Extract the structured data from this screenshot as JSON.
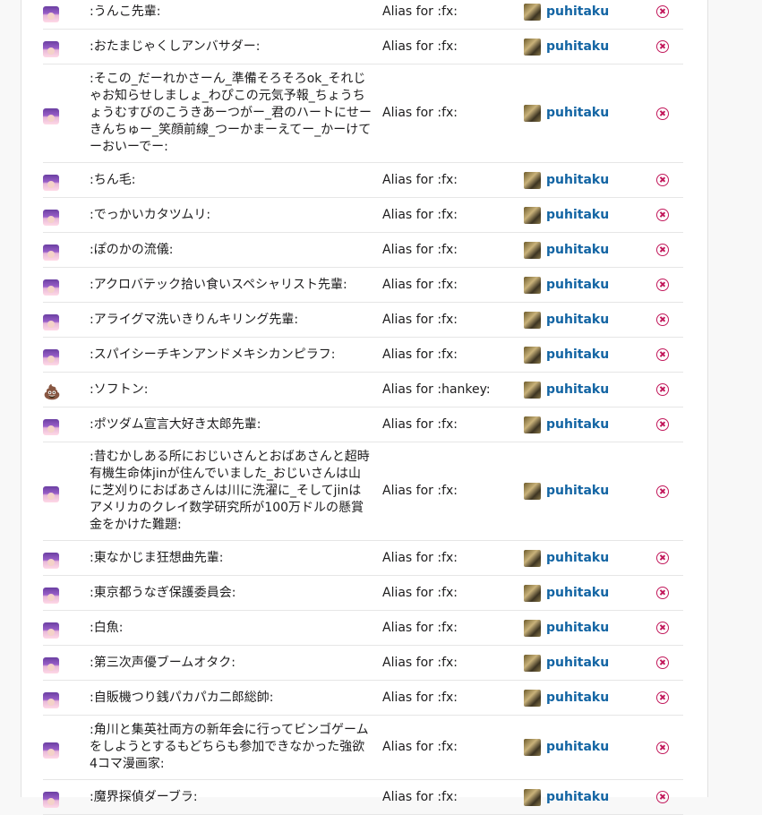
{
  "colors": {
    "link": "#1264a3",
    "remove": "#c2185b",
    "border": "#e6e6e6"
  },
  "rows": [
    {
      "emoji_icon": "anime-avatar-icon",
      "name": ":うんこ先輩:",
      "source": "Alias for :fx:",
      "user": "puhitaku"
    },
    {
      "emoji_icon": "anime-avatar-icon",
      "name": ":おたまじゃくしアンバサダー:",
      "source": "Alias for :fx:",
      "user": "puhitaku"
    },
    {
      "emoji_icon": "anime-avatar-icon",
      "name": ":そこの_だーれかさーん_準備そろそろok_それじゃお知らせしましょ_わぴこの元気予報_ちょうちょうむすびのこうきあーつがー_君のハートにせーきんちゅー_笑顔前線_つーかまーえてー_かーけてーおいーでー:",
      "source": "Alias for :fx:",
      "user": "puhitaku"
    },
    {
      "emoji_icon": "anime-avatar-icon",
      "name": ":ちん毛:",
      "source": "Alias for :fx:",
      "user": "puhitaku"
    },
    {
      "emoji_icon": "anime-avatar-icon",
      "name": ":でっかいカタツムリ:",
      "source": "Alias for :fx:",
      "user": "puhitaku"
    },
    {
      "emoji_icon": "anime-avatar-icon",
      "name": ":ぽのかの流儀:",
      "source": "Alias for :fx:",
      "user": "puhitaku"
    },
    {
      "emoji_icon": "anime-avatar-icon",
      "name": ":アクロバテック拾い食いスペシャリスト先輩:",
      "source": "Alias for :fx:",
      "user": "puhitaku"
    },
    {
      "emoji_icon": "anime-avatar-icon",
      "name": ":アライグマ洗いきりんキリング先輩:",
      "source": "Alias for :fx:",
      "user": "puhitaku"
    },
    {
      "emoji_icon": "anime-avatar-icon",
      "name": ":スパイシーチキンアンドメキシカンピラフ:",
      "source": "Alias for :fx:",
      "user": "puhitaku"
    },
    {
      "emoji_icon": "poop-icon",
      "name": ":ソフトン:",
      "source": "Alias for :hankey:",
      "user": "puhitaku"
    },
    {
      "emoji_icon": "anime-avatar-icon",
      "name": ":ポツダム宣言大好き太郎先輩:",
      "source": "Alias for :fx:",
      "user": "puhitaku"
    },
    {
      "emoji_icon": "anime-avatar-icon",
      "name": ":昔むかしある所におじいさんとおばあさんと超時有機生命体jinが住んでいました_おじいさんは山に芝刈りにおばあさんは川に洗濯に_そしてjinはアメリカのクレイ数学研究所が100万ドルの懸賞金をかけた難題:",
      "source": "Alias for :fx:",
      "user": "puhitaku"
    },
    {
      "emoji_icon": "anime-avatar-icon",
      "name": ":東なかじま狂想曲先輩:",
      "source": "Alias for :fx:",
      "user": "puhitaku"
    },
    {
      "emoji_icon": "anime-avatar-icon",
      "name": ":東京都うなぎ保護委員会:",
      "source": "Alias for :fx:",
      "user": "puhitaku"
    },
    {
      "emoji_icon": "anime-avatar-icon",
      "name": ":白魚:",
      "source": "Alias for :fx:",
      "user": "puhitaku"
    },
    {
      "emoji_icon": "anime-avatar-icon",
      "name": ":第三次声優ブームオタク:",
      "source": "Alias for :fx:",
      "user": "puhitaku"
    },
    {
      "emoji_icon": "anime-avatar-icon",
      "name": ":自販機つり銭パカパカ二郎総帥:",
      "source": "Alias for :fx:",
      "user": "puhitaku"
    },
    {
      "emoji_icon": "anime-avatar-icon",
      "name": ":角川と集英社両方の新年会に行ってビンゴゲームをしようとするもどちらも参加できなかった強欲4コマ漫画家:",
      "source": "Alias for :fx:",
      "user": "puhitaku"
    },
    {
      "emoji_icon": "anime-avatar-icon",
      "name": ":魔界探偵ダーブラ:",
      "source": "Alias for :fx:",
      "user": "puhitaku"
    }
  ]
}
